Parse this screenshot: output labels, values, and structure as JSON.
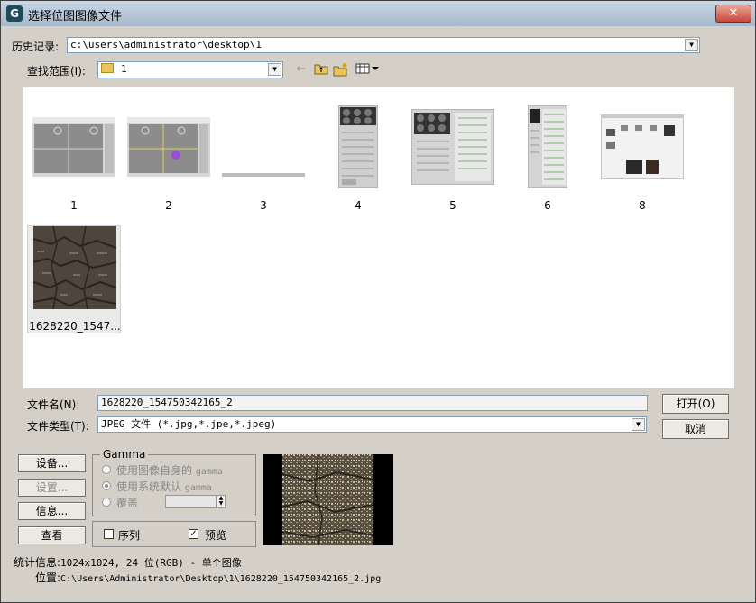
{
  "window": {
    "title": "选择位图图像文件",
    "close_label": "✕"
  },
  "history": {
    "label": "历史记录:",
    "value": "c:\\users\\administrator\\desktop\\1"
  },
  "lookin": {
    "label": "查找范围(I):",
    "value": "1"
  },
  "files": [
    {
      "name": "1",
      "kind": "viewport"
    },
    {
      "name": "2",
      "kind": "viewport-sphere"
    },
    {
      "name": "3",
      "kind": "thin-bar"
    },
    {
      "name": "4",
      "kind": "material-editor"
    },
    {
      "name": "5",
      "kind": "material-editor-wide"
    },
    {
      "name": "6",
      "kind": "panel-tall"
    },
    {
      "name": "8",
      "kind": "dialog-screenshot"
    },
    {
      "name": "1628220_1547...",
      "kind": "rock-texture",
      "selected": true
    }
  ],
  "filename": {
    "label": "文件名(N):",
    "value": "1628220_154750342165_2"
  },
  "filetype": {
    "label": "文件类型(T):",
    "value": "JPEG 文件 (*.jpg,*.jpe,*.jpeg)"
  },
  "buttons": {
    "open": "打开(O)",
    "cancel": "取消",
    "setup1": "设备...",
    "setup2": "设置...",
    "info": "信息...",
    "view": "查看"
  },
  "gamma": {
    "title": "Gamma",
    "opt1_prefix": "使用图像自身的",
    "opt1_suffix": "gamma",
    "opt2_prefix": "使用系统默认",
    "opt2_suffix": "gamma",
    "opt3": "覆盖",
    "selected": 2
  },
  "options": {
    "sequence_label": "序列",
    "sequence_checked": false,
    "preview_label": "预览",
    "preview_checked": true
  },
  "stats": {
    "label": "统计信息:",
    "value": "1024x1024, 24 位(RGB) - 单个图像"
  },
  "location": {
    "label": "位置:",
    "value": "C:\\Users\\Administrator\\Desktop\\1\\1628220_154750342165_2.jpg"
  },
  "colors": {
    "titlebar": "#b3c4d7",
    "dialog_bg": "#d4d0c8",
    "close": "#c8473a",
    "folder": "#e8c45a"
  }
}
